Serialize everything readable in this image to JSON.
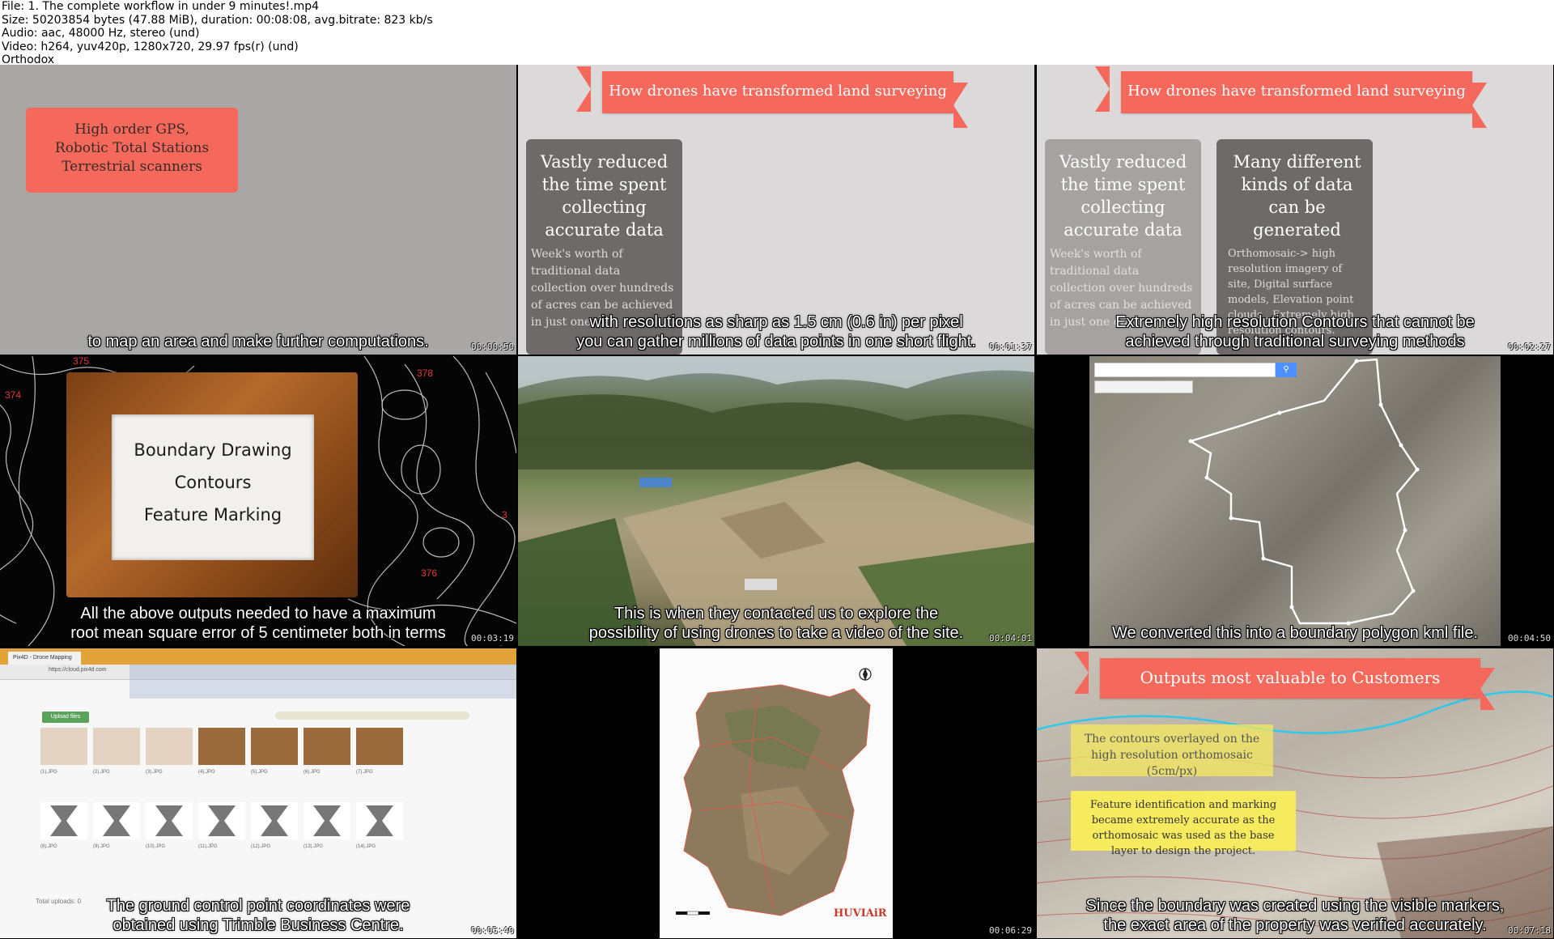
{
  "header": {
    "line1": "File: 1. The complete workflow in under 9 minutes!.mp4",
    "line2": "Size: 50203854 bytes (47.88 MiB), duration: 00:08:08, avg.bitrate: 823 kb/s",
    "line3": "Audio: aac, 48000 Hz, stereo (und)",
    "line4": "Video: h264, yuv420p, 1280x720, 29.97 fps(r) (und)",
    "line5": "Orthodox"
  },
  "tiles": [
    {
      "card_lines": [
        "High order GPS,",
        "Robotic Total Stations",
        "Terrestrial scanners"
      ],
      "subtitle1": "to map an area and make further computations.",
      "subtitle2": "",
      "timestamp": "00:00:50"
    },
    {
      "banner": "How drones have transformed land surveying",
      "card1_title": "Vastly reduced the time spent collecting accurate data",
      "card1_body": "Week's worth of traditional data collection over hundreds of acres can be achieved in just one day.",
      "subtitle1": "with resolutions as sharp as 1.5 cm (0.6 in) per pixel",
      "subtitle2": "you can gather millions of data points in one short flight.",
      "timestamp": "00:01:37"
    },
    {
      "banner": "How drones have transformed land surveying",
      "card1_title": "Vastly reduced the time spent collecting accurate data",
      "card1_body": "Week's worth of traditional data collection over hundreds of acres can be achieved in just one day.",
      "card2_title": "Many different kinds of data can be generated",
      "card2_body": "Orthomosaic-> high resolution imagery of site, Digital surface models, Elevation point clouds , Extremely high resolution contours.",
      "subtitle1": "Extremely high resolution Contours that cannot be",
      "subtitle2": "achieved through traditional surveying methods",
      "timestamp": "00:02:27"
    },
    {
      "frame_lines": [
        "Boundary Drawing",
        "Contours",
        "Feature Marking"
      ],
      "contour_labels": [
        "375",
        "374",
        "378",
        "376",
        "3"
      ],
      "subtitle1": "All the above outputs needed to have a maximum",
      "subtitle2": "root mean square error of 5 centimeter both in terms",
      "timestamp": "00:03:19"
    },
    {
      "subtitle1": "This is when they contacted us to explore the",
      "subtitle2": "possibility of using drones to take a video of the site.",
      "timestamp": "00:04:01"
    },
    {
      "subtitle1": "We converted this into a boundary polygon kml file.",
      "subtitle2": "",
      "timestamp": "00:04:50"
    },
    {
      "browser_tab": "Pix4D - Drone Mapping",
      "browser_url": "https://cloud.pix4d.com",
      "upload_button": "Upload files",
      "files": [
        "(1).JPG",
        "(2).JPG",
        "(3).JPG",
        "(4).JPG",
        "(5).JPG",
        "(6).JPG",
        "(7).JPG",
        "(8).JPG",
        "(9).JPG",
        "(10).JPG",
        "(11).JPG",
        "(12).JPG",
        "(13).JPG",
        "(14).JPG"
      ],
      "total_uploads": "Total uploads: 0",
      "subtitle1": "The ground control point coordinates were",
      "subtitle2": "obtained using Trimble Business Centre.",
      "timestamp": "00:05:40"
    },
    {
      "logo": "HUVIAiR",
      "subtitle1": "",
      "subtitle2": "",
      "timestamp": "00:06:29"
    },
    {
      "banner": "Outputs most valuable to Customers",
      "note1": "The contours overlayed on the high resolution orthomosaic (5cm/px)",
      "note2": "Feature identification and marking became extremely accurate as the orthomosaic was used as the base layer to design the project.",
      "subtitle1": "Since the boundary was created using the visible markers,",
      "subtitle2": "the exact area of the property was verified accurately.",
      "timestamp": "00:07:18"
    }
  ],
  "colors": {
    "banner": "#f4695b",
    "card_dark": "#6e6a69",
    "note_yellow": "#f6ea5e"
  }
}
